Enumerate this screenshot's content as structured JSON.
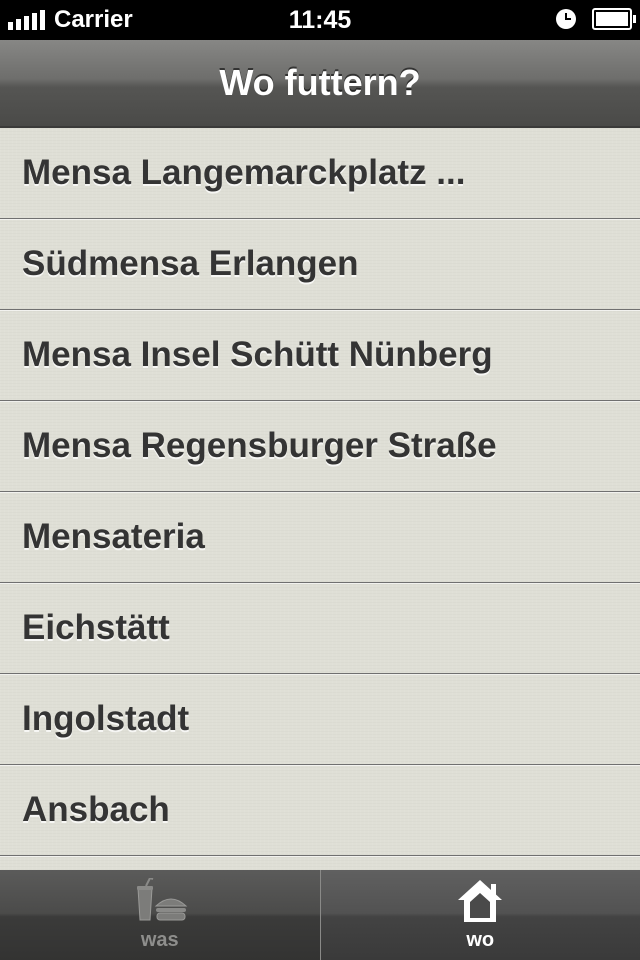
{
  "status_bar": {
    "carrier": "Carrier",
    "time": "11:45",
    "signal_bars": 5,
    "icons": [
      "signal-icon",
      "alarm-icon",
      "battery-icon"
    ]
  },
  "nav": {
    "title": "Wo futtern?"
  },
  "list": {
    "items": [
      {
        "label": "Mensa Langemarckplatz ..."
      },
      {
        "label": "Südmensa Erlangen"
      },
      {
        "label": "Mensa Insel Schütt Nünberg"
      },
      {
        "label": "Mensa Regensburger Straße"
      },
      {
        "label": "Mensateria"
      },
      {
        "label": "Eichstätt"
      },
      {
        "label": "Ingolstadt"
      },
      {
        "label": "Ansbach"
      }
    ]
  },
  "tab_bar": {
    "tabs": [
      {
        "label": "was",
        "icon": "drink-burger-icon",
        "active": false
      },
      {
        "label": "wo",
        "icon": "house-icon",
        "active": true
      }
    ]
  },
  "colors": {
    "nav_bar": "#6e6e6c",
    "list_background": "#dfdfd6",
    "list_text": "#343434",
    "tab_bar": "#444443",
    "active_tab_text": "#ffffff",
    "inactive_tab_text": "#8e8e8c"
  }
}
